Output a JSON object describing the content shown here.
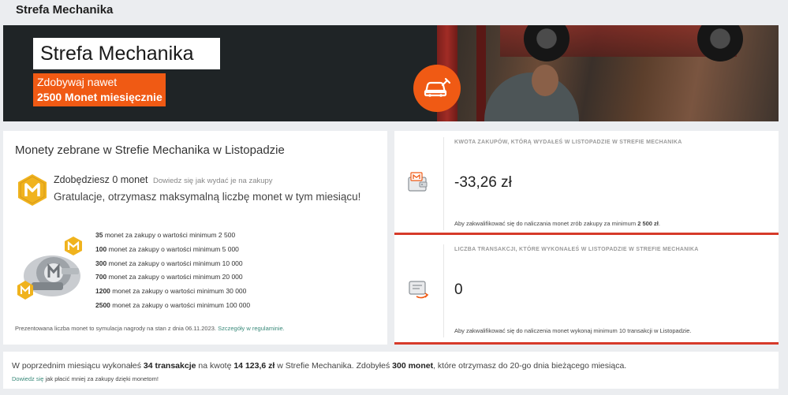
{
  "topbar": {
    "title": "Strefa Mechanika"
  },
  "hero": {
    "brand": "Strefa Mechanika",
    "promo_line1": "Zdobywaj nawet",
    "promo_line2": "2500 Monet miesięcznie",
    "badge_icon": "car-wrench-icon"
  },
  "coins": {
    "heading": "Monety zebrane w Strefie Mechanika w Listopadzie",
    "earn_text": "Zdobędziesz 0 monet",
    "learn_link": "Dowiedz się jak wydać je na zakupy",
    "congrats": "Gratulacje, otrzymasz maksymalną liczbę monet w tym miesiącu!",
    "tiers": [
      {
        "amount": "35",
        "text": "monet za zakupy o wartości minimum 2 500"
      },
      {
        "amount": "100",
        "text": "monet za zakupy o wartości minimum 5 000"
      },
      {
        "amount": "300",
        "text": "monet za zakupy o wartości minimum 10 000"
      },
      {
        "amount": "700",
        "text": "monet za zakupy o wartości minimum 20 000"
      },
      {
        "amount": "1200",
        "text": "monet za zakupy o wartości minimum 30 000"
      },
      {
        "amount": "2500",
        "text": "monet za zakupy o wartości minimum 100 000"
      }
    ],
    "note": "Prezentowana liczba monet to symulacja nagrody na stan z dnia 06.11.2023.",
    "note_link": "Szczegóły w regulaminie."
  },
  "stats": {
    "purchase": {
      "label": "KWOTA ZAKUPÓW, KTÓRĄ WYDAŁEŚ W LISTOPADZIE W STREFIE MECHANIKA",
      "value": "-33,26 zł",
      "foot_pre": "Aby zakwalifikować się do naliczania monet zrób zakupy za minimum",
      "foot_bold": "2 500 zł",
      "foot_post": "."
    },
    "transactions": {
      "label": "LICZBA TRANSAKCJI, KTÓRE WYKONAŁEŚ W LISTOPADZIE W STREFIE MECHANIKA",
      "value": "0",
      "foot": "Aby zakwalifikować się do naliczenia monet wykonaj minimum 10 transakcji w Listopadzie."
    }
  },
  "summary": {
    "p1": "W poprzednim miesiącu wykonałeś",
    "b1": "34 transakcje",
    "p2": "na kwotę",
    "b2": "14 123,6 zł",
    "p3": "w Strefie Mechanika. Zdobyłeś",
    "b3": "300 monet",
    "p4": ", które otrzymasz do 20-go dnia bieżącego miesiąca.",
    "link": "Dowiedz się",
    "more": "jak płacić mniej za zakupy dzięki monetom!"
  },
  "colors": {
    "accent": "#f05a14",
    "coin": "#f0b31e",
    "alert": "#d63a2a",
    "link": "#3a8a7a"
  }
}
